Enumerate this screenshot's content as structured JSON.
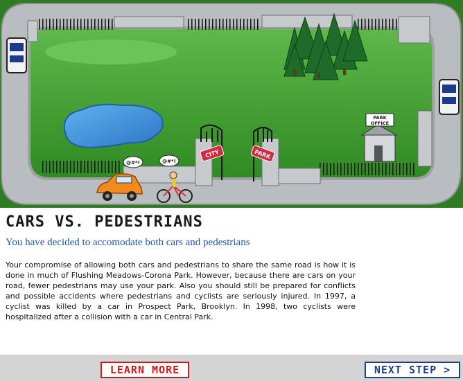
{
  "scene": {
    "gate_left_sign": "CITY",
    "gate_right_sign": "PARK",
    "office_sign_line1": "PARK",
    "office_sign_line2": "OFFICE",
    "speech_car": "@#*!",
    "speech_cyclist": "@#*!"
  },
  "content": {
    "heading": "CARS VS. PEDESTRIANS",
    "subheading": "You have decided to accomodate both cars and pedestrians",
    "body": "Your compromise of allowing both cars and pedestrians to share the same road is how it is done in much of Flushing Meadows-Corona Park. However, because there are cars on your road, fewer pedestrians may use your park. Also you should still be prepared for conflicts and possible accidents where pedestrians and cyclists are seriously injured. In 1997, a cyclist was killed by a car in Prospect Park, Brooklyn. In 1998, two cyclists were hospitalized after a collision with a car in Central Park."
  },
  "footer": {
    "learn_more": "LEARN MORE",
    "next_step": "NEXT STEP >"
  },
  "colors": {
    "grass": "#3f9a2e",
    "road": "#b9bcc0",
    "pond": "#3a8fd6",
    "heading_blue": "#1f55a8",
    "learn_red": "#d21a1a",
    "next_blue": "#1f3f8f"
  }
}
